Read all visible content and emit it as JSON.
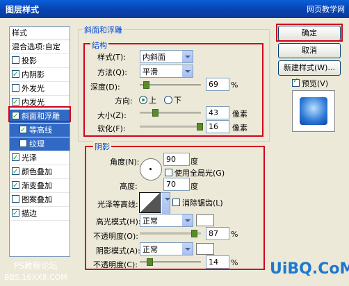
{
  "window": {
    "title": "图层样式",
    "site_watermark": "网页教学网"
  },
  "left_panel": {
    "header": "样式",
    "items": [
      {
        "label": "混合选项:自定",
        "checkbox": false,
        "checked": false
      },
      {
        "label": "投影",
        "checkbox": true,
        "checked": false
      },
      {
        "label": "内阴影",
        "checkbox": true,
        "checked": true
      },
      {
        "label": "外发光",
        "checkbox": true,
        "checked": false
      },
      {
        "label": "内发光",
        "checkbox": true,
        "checked": true
      },
      {
        "label": "斜面和浮雕",
        "checkbox": true,
        "checked": true
      },
      {
        "label": "等高线",
        "checkbox": true,
        "checked": true
      },
      {
        "label": "纹理",
        "checkbox": true,
        "checked": false
      },
      {
        "label": "光泽",
        "checkbox": true,
        "checked": true
      },
      {
        "label": "颜色叠加",
        "checkbox": true,
        "checked": true
      },
      {
        "label": "渐变叠加",
        "checkbox": true,
        "checked": true
      },
      {
        "label": "图案叠加",
        "checkbox": true,
        "checked": false
      },
      {
        "label": "描边",
        "checkbox": true,
        "checked": true
      }
    ]
  },
  "bevel": {
    "group_title": "斜面和浮雕",
    "structure_title": "结构",
    "style_label": "样式(T):",
    "style_value": "内斜面",
    "method_label": "方法(Q):",
    "method_value": "平滑",
    "depth_label": "深度(D):",
    "depth_value": "69",
    "depth_unit": "%",
    "depth_pct": 0.1,
    "direction_label": "方向:",
    "direction_up": "上",
    "direction_down": "下",
    "size_label": "大小(Z):",
    "size_value": "43",
    "size_unit": "像素",
    "size_pct": 0.2,
    "soften_label": "软化(F):",
    "soften_value": "16",
    "soften_unit": "像素",
    "soften_pct": 0.95
  },
  "shading": {
    "title": "阴影",
    "angle_label": "角度(N):",
    "angle_value": "90",
    "angle_unit": "度",
    "global_light": "使用全局光(G)",
    "altitude_label": "高度:",
    "altitude_value": "70",
    "altitude_unit": "度",
    "gloss_contour_label": "光泽等高线:",
    "anti_alias": "消除锯齿(L)",
    "highlight_mode_label": "高光模式(H):",
    "highlight_mode_value": "正常",
    "highlight_opacity_label": "不透明度(O):",
    "highlight_opacity_value": "87",
    "highlight_opacity_pct": 0.87,
    "shadow_mode_label": "阴影模式(A):",
    "shadow_mode_value": "正常",
    "shadow_opacity_label": "不透明度(C):",
    "shadow_opacity_value": "14",
    "shadow_opacity_pct": 0.14,
    "unit_pct": "%"
  },
  "buttons": {
    "ok": "确定",
    "cancel": "取消",
    "new_style": "新建样式(W)...",
    "preview": "预览(V)"
  },
  "watermarks": {
    "bottom_left_1": "PS教程论坛",
    "bottom_left_2": "BBS.16XX8.COM",
    "bottom_right": "UiBQ.CoM"
  },
  "colors": {
    "accent_red": "#d0021b",
    "selection_blue": "#316ac5",
    "title_blue": "#0a5fd8"
  }
}
